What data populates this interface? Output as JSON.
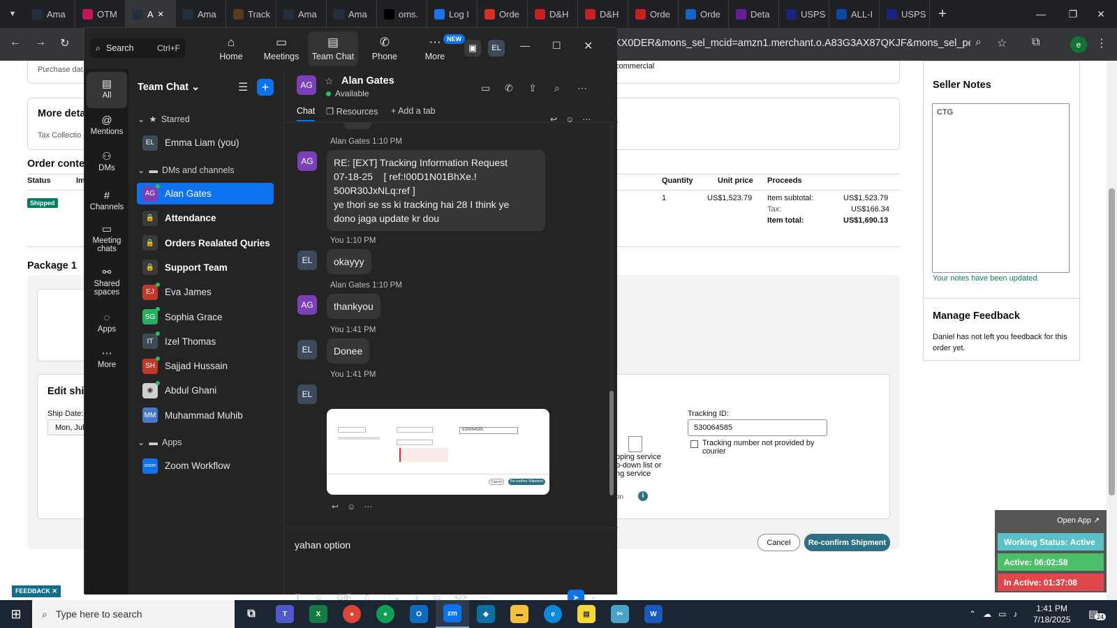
{
  "browser": {
    "tabs": [
      {
        "label": "Ama",
        "icon": "amazon-icon",
        "color": "#232f3e"
      },
      {
        "label": "OTM",
        "icon": "otm-icon",
        "color": "#c2185b"
      },
      {
        "label": "A",
        "icon": "amazon-icon",
        "color": "#232f3e",
        "active": true
      },
      {
        "label": "Ama",
        "icon": "amazon-icon",
        "color": "#232f3e"
      },
      {
        "label": "Track",
        "icon": "ups-icon",
        "color": "#5a3a1a"
      },
      {
        "label": "Ama",
        "icon": "amazon-icon",
        "color": "#232f3e"
      },
      {
        "label": "Ama",
        "icon": "amazon-icon",
        "color": "#232f3e"
      },
      {
        "label": "oms.",
        "icon": "oms-icon",
        "color": "#000000"
      },
      {
        "label": "Log I",
        "icon": "login-icon",
        "color": "#1a73e8"
      },
      {
        "label": "Orde",
        "icon": "order-icon",
        "color": "#d93025"
      },
      {
        "label": "D&H",
        "icon": "dh-icon",
        "color": "#c5221f"
      },
      {
        "label": "D&H",
        "icon": "dh-icon",
        "color": "#c5221f"
      },
      {
        "label": "Orde",
        "icon": "dh-icon",
        "color": "#c5221f"
      },
      {
        "label": "Orde",
        "icon": "ec-icon",
        "color": "#1565c0"
      },
      {
        "label": "Deta",
        "icon": "deta-icon",
        "color": "#6a1b9a"
      },
      {
        "label": "USPS",
        "icon": "usps-icon",
        "color": "#1a237e"
      },
      {
        "label": "ALL-I",
        "icon": "all-icon",
        "color": "#0d47a1"
      },
      {
        "label": "USPS",
        "icon": "usps-icon",
        "color": "#1a237e"
      }
    ],
    "new_tab": "+",
    "url": "KX0DER&mons_sel_mcid=amzn1.merchant.o.A83G3AX87QKJF&mons_sel_persi...",
    "profile_initial": "e"
  },
  "amazon": {
    "purchase_date": "Purchase dat",
    "commercial": "commercial",
    "more_details": "More deta",
    "tax_collection": "Tax Collectio",
    "order_contents": "Order conte",
    "col_status": "Status",
    "col_im": "Im",
    "col_quantity": "Quantity",
    "col_unit_price": "Unit price",
    "col_proceeds": "Proceeds",
    "shipped": "Shipped",
    "quantity": "1",
    "unit_price": "US$1,523.79",
    "item_subtotal_label": "Item subtotal:",
    "item_subtotal": "US$1,523.79",
    "tax_label": "Tax:",
    "tax": "US$166.34",
    "item_total_label": "Item total:",
    "item_total": "US$1,690.13",
    "package": "Package 1",
    "edit_ship": "Edit ship",
    "ship_date_label": "Ship Date:",
    "ship_date_value": "Mon, Jul",
    "tracking_id_label": "Tracking ID:",
    "tracking_id_value": "530064585",
    "tracking_not_provided": "Tracking number not provided by courier",
    "shipping_service_1": "pping service",
    "shipping_service_2": "p-down list or",
    "shipping_service_3": "ng service",
    "option_frag": "on",
    "cancel": "Cancel",
    "reconfirm": "Re-confirm Shipment",
    "seller_notes_title": "Seller Notes",
    "seller_notes_value": "CTG",
    "notes_updated": "Your notes have been updated.",
    "manage_feedback_title": "Manage Feedback",
    "feedback_text": "Daniel has not left you feedback for this order yet.",
    "feedback_tag": "FEEDBACK"
  },
  "zoom": {
    "search_placeholder": "Search",
    "search_shortcut": "Ctrl+F",
    "nav": [
      {
        "label": "Home",
        "icon": "home-icon"
      },
      {
        "label": "Meetings",
        "icon": "meetings-icon"
      },
      {
        "label": "Team Chat",
        "icon": "team-chat-icon",
        "active": true
      },
      {
        "label": "Phone",
        "icon": "phone-icon"
      },
      {
        "label": "More",
        "icon": "more-icon"
      }
    ],
    "new_badge": "NEW",
    "user_initials": "EL",
    "rail": [
      {
        "label": "All",
        "active": true
      },
      {
        "label": "Mentions"
      },
      {
        "label": "DMs"
      },
      {
        "label": "Channels"
      },
      {
        "label": "Meeting chats"
      },
      {
        "label": "Shared spaces"
      },
      {
        "label": "Apps"
      },
      {
        "label": "More"
      }
    ],
    "sidebar_title": "Team Chat",
    "starred_label": "Starred",
    "dms_label": "DMs and channels",
    "apps_label": "Apps",
    "starred": [
      {
        "initials": "EL",
        "name": "Emma Liam (you)",
        "color": "#3c4a5a"
      }
    ],
    "channels": [
      {
        "initials": "AG",
        "name": "Alan Gates",
        "color": "#7b3fb8",
        "selected": true,
        "online": true
      },
      {
        "initials": "",
        "name": "Attendance",
        "locked": true,
        "bold": true
      },
      {
        "initials": "",
        "name": "Orders Realated Quries",
        "locked": true,
        "bold": true
      },
      {
        "initials": "",
        "name": "Support Team",
        "locked": true,
        "bold": true
      },
      {
        "initials": "EJ",
        "name": "Eva James",
        "color": "#c0392b",
        "online": true
      },
      {
        "initials": "SG",
        "name": "Sophia Grace",
        "color": "#27ae60",
        "online": true
      },
      {
        "initials": "IT",
        "name": "Izel Thomas",
        "color": "#3c4a5a",
        "online": true
      },
      {
        "initials": "SH",
        "name": "Sajjad Hussain",
        "color": "#c0392b",
        "online": true
      },
      {
        "initials": "",
        "name": "Abdul Ghani",
        "photo": true,
        "online": true
      },
      {
        "initials": "MM",
        "name": "Muhammad Muhib",
        "color": "#4a78c8"
      }
    ],
    "apps": [
      {
        "initials": "zoom",
        "name": "Zoom Workflow",
        "color": "#0e72ed"
      }
    ],
    "chat": {
      "contact_initials": "AG",
      "contact_name": "Alan Gates",
      "contact_status": "Available",
      "tab_chat": "Chat",
      "tab_resources": "Resources",
      "tab_add": "Add a tab",
      "messages": [
        {
          "initials": "AG",
          "sender": "Alan Gates",
          "time": "1:10 PM",
          "lines": [
            "RE: [EXT] Tracking Information Request",
            "07-18-25    [ ref:!00D1N01BhXe.!",
            "500R30JxNLq:ref ]",
            "ye thori se ss ki tracking hai 28 I think ye",
            "dono jaga update kr dou"
          ]
        },
        {
          "initials": "EL",
          "sender": "You",
          "time": "1:10 PM",
          "lines": [
            "okayyy"
          ]
        },
        {
          "initials": "AG",
          "sender": "Alan Gates",
          "time": "1:10 PM",
          "lines": [
            "thankyou"
          ]
        },
        {
          "initials": "EL",
          "sender": "You",
          "time": "1:41 PM",
          "lines": [
            "Donee"
          ]
        },
        {
          "initials": "EL",
          "sender": "You",
          "time": "1:41 PM",
          "lines": []
        }
      ],
      "compose_text": "yahan option",
      "screenshot": {
        "tracking_id": "530064585",
        "cancel": "Cancel",
        "confirm": "Re-confirm Shipment"
      }
    }
  },
  "status_widget": {
    "open_app": "Open App ↗",
    "working_status": "Working Status: Active",
    "active": "Active: 06:02:58",
    "inactive": "In Active: 01:37:08",
    "colors": {
      "working": "#5bc0c8",
      "active": "#4cbf6a",
      "inactive": "#e0474c"
    }
  },
  "taskbar": {
    "search_placeholder": "Type here to search",
    "time": "1:41 PM",
    "date": "7/18/2025",
    "notifications": "24"
  }
}
